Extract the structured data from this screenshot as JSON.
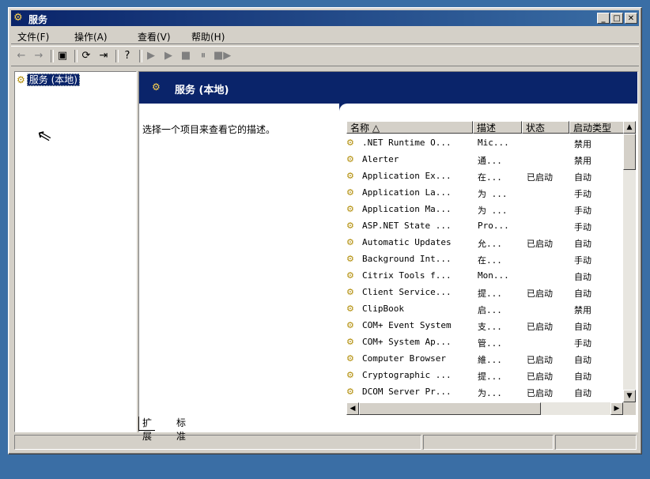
{
  "window": {
    "title": "服务"
  },
  "menu": [
    "文件(F)",
    "操作(A)",
    "查看(V)",
    "帮助(H)"
  ],
  "tree": {
    "item": "服务 (本地)"
  },
  "banner": {
    "title": "服务 (本地)"
  },
  "description": "选择一个项目来查看它的描述。",
  "columns": [
    "名称 △",
    "描述",
    "状态",
    "启动类型"
  ],
  "services": [
    {
      "name": ".NET Runtime O...",
      "desc": "Mic...",
      "status": "",
      "startup": "禁用"
    },
    {
      "name": "Alerter",
      "desc": "通...",
      "status": "",
      "startup": "禁用"
    },
    {
      "name": "Application Ex...",
      "desc": "在...",
      "status": "已启动",
      "startup": "自动"
    },
    {
      "name": "Application La...",
      "desc": "为 ...",
      "status": "",
      "startup": "手动"
    },
    {
      "name": "Application Ma...",
      "desc": "为 ...",
      "status": "",
      "startup": "手动"
    },
    {
      "name": "ASP.NET State ...",
      "desc": "Pro...",
      "status": "",
      "startup": "手动"
    },
    {
      "name": "Automatic Updates",
      "desc": "允...",
      "status": "已启动",
      "startup": "自动"
    },
    {
      "name": "Background Int...",
      "desc": "在...",
      "status": "",
      "startup": "手动"
    },
    {
      "name": "Citrix Tools f...",
      "desc": "Mon...",
      "status": "",
      "startup": "自动"
    },
    {
      "name": "Client Service...",
      "desc": "提...",
      "status": "已启动",
      "startup": "自动"
    },
    {
      "name": "ClipBook",
      "desc": "启...",
      "status": "",
      "startup": "禁用"
    },
    {
      "name": "COM+ Event System",
      "desc": "支...",
      "status": "已启动",
      "startup": "自动"
    },
    {
      "name": "COM+ System Ap...",
      "desc": "管...",
      "status": "",
      "startup": "手动"
    },
    {
      "name": "Computer Browser",
      "desc": "維...",
      "status": "已启动",
      "startup": "自动"
    },
    {
      "name": "Cryptographic ...",
      "desc": "提...",
      "status": "已启动",
      "startup": "自动"
    },
    {
      "name": "DCOM Server Pr...",
      "desc": "为...",
      "status": "已启动",
      "startup": "自动"
    }
  ],
  "tabs": [
    "扩展",
    "标准"
  ],
  "icons": {
    "service": "gears-icon",
    "app": "services-app-icon"
  }
}
